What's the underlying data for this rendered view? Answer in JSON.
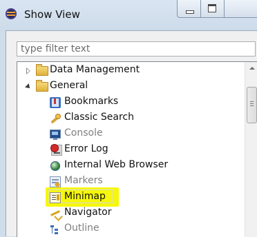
{
  "window": {
    "title": "Show View"
  },
  "filter": {
    "placeholder": "type filter text"
  },
  "tree": {
    "items": [
      {
        "label": "Data Management",
        "icon": "folder-icon",
        "state": "collapsed"
      },
      {
        "label": "General",
        "icon": "folder-open-icon",
        "state": "expanded"
      },
      {
        "label": "Bookmarks",
        "icon": "bookmarks-icon",
        "enabled": true
      },
      {
        "label": "Classic Search",
        "icon": "search-icon",
        "enabled": true
      },
      {
        "label": "Console",
        "icon": "console-icon",
        "enabled": false
      },
      {
        "label": "Error Log",
        "icon": "error-log-icon",
        "enabled": true
      },
      {
        "label": "Internal Web Browser",
        "icon": "globe-icon",
        "enabled": true
      },
      {
        "label": "Markers",
        "icon": "markers-icon",
        "enabled": false
      },
      {
        "label": "Minimap",
        "icon": "minimap-icon",
        "enabled": true,
        "highlighted": true
      },
      {
        "label": "Navigator",
        "icon": "navigator-icon",
        "enabled": true
      },
      {
        "label": "Outline",
        "icon": "outline-icon",
        "enabled": false
      }
    ]
  },
  "colors": {
    "highlight": "#f6f700",
    "disabled_text": "#7f7f7f"
  }
}
